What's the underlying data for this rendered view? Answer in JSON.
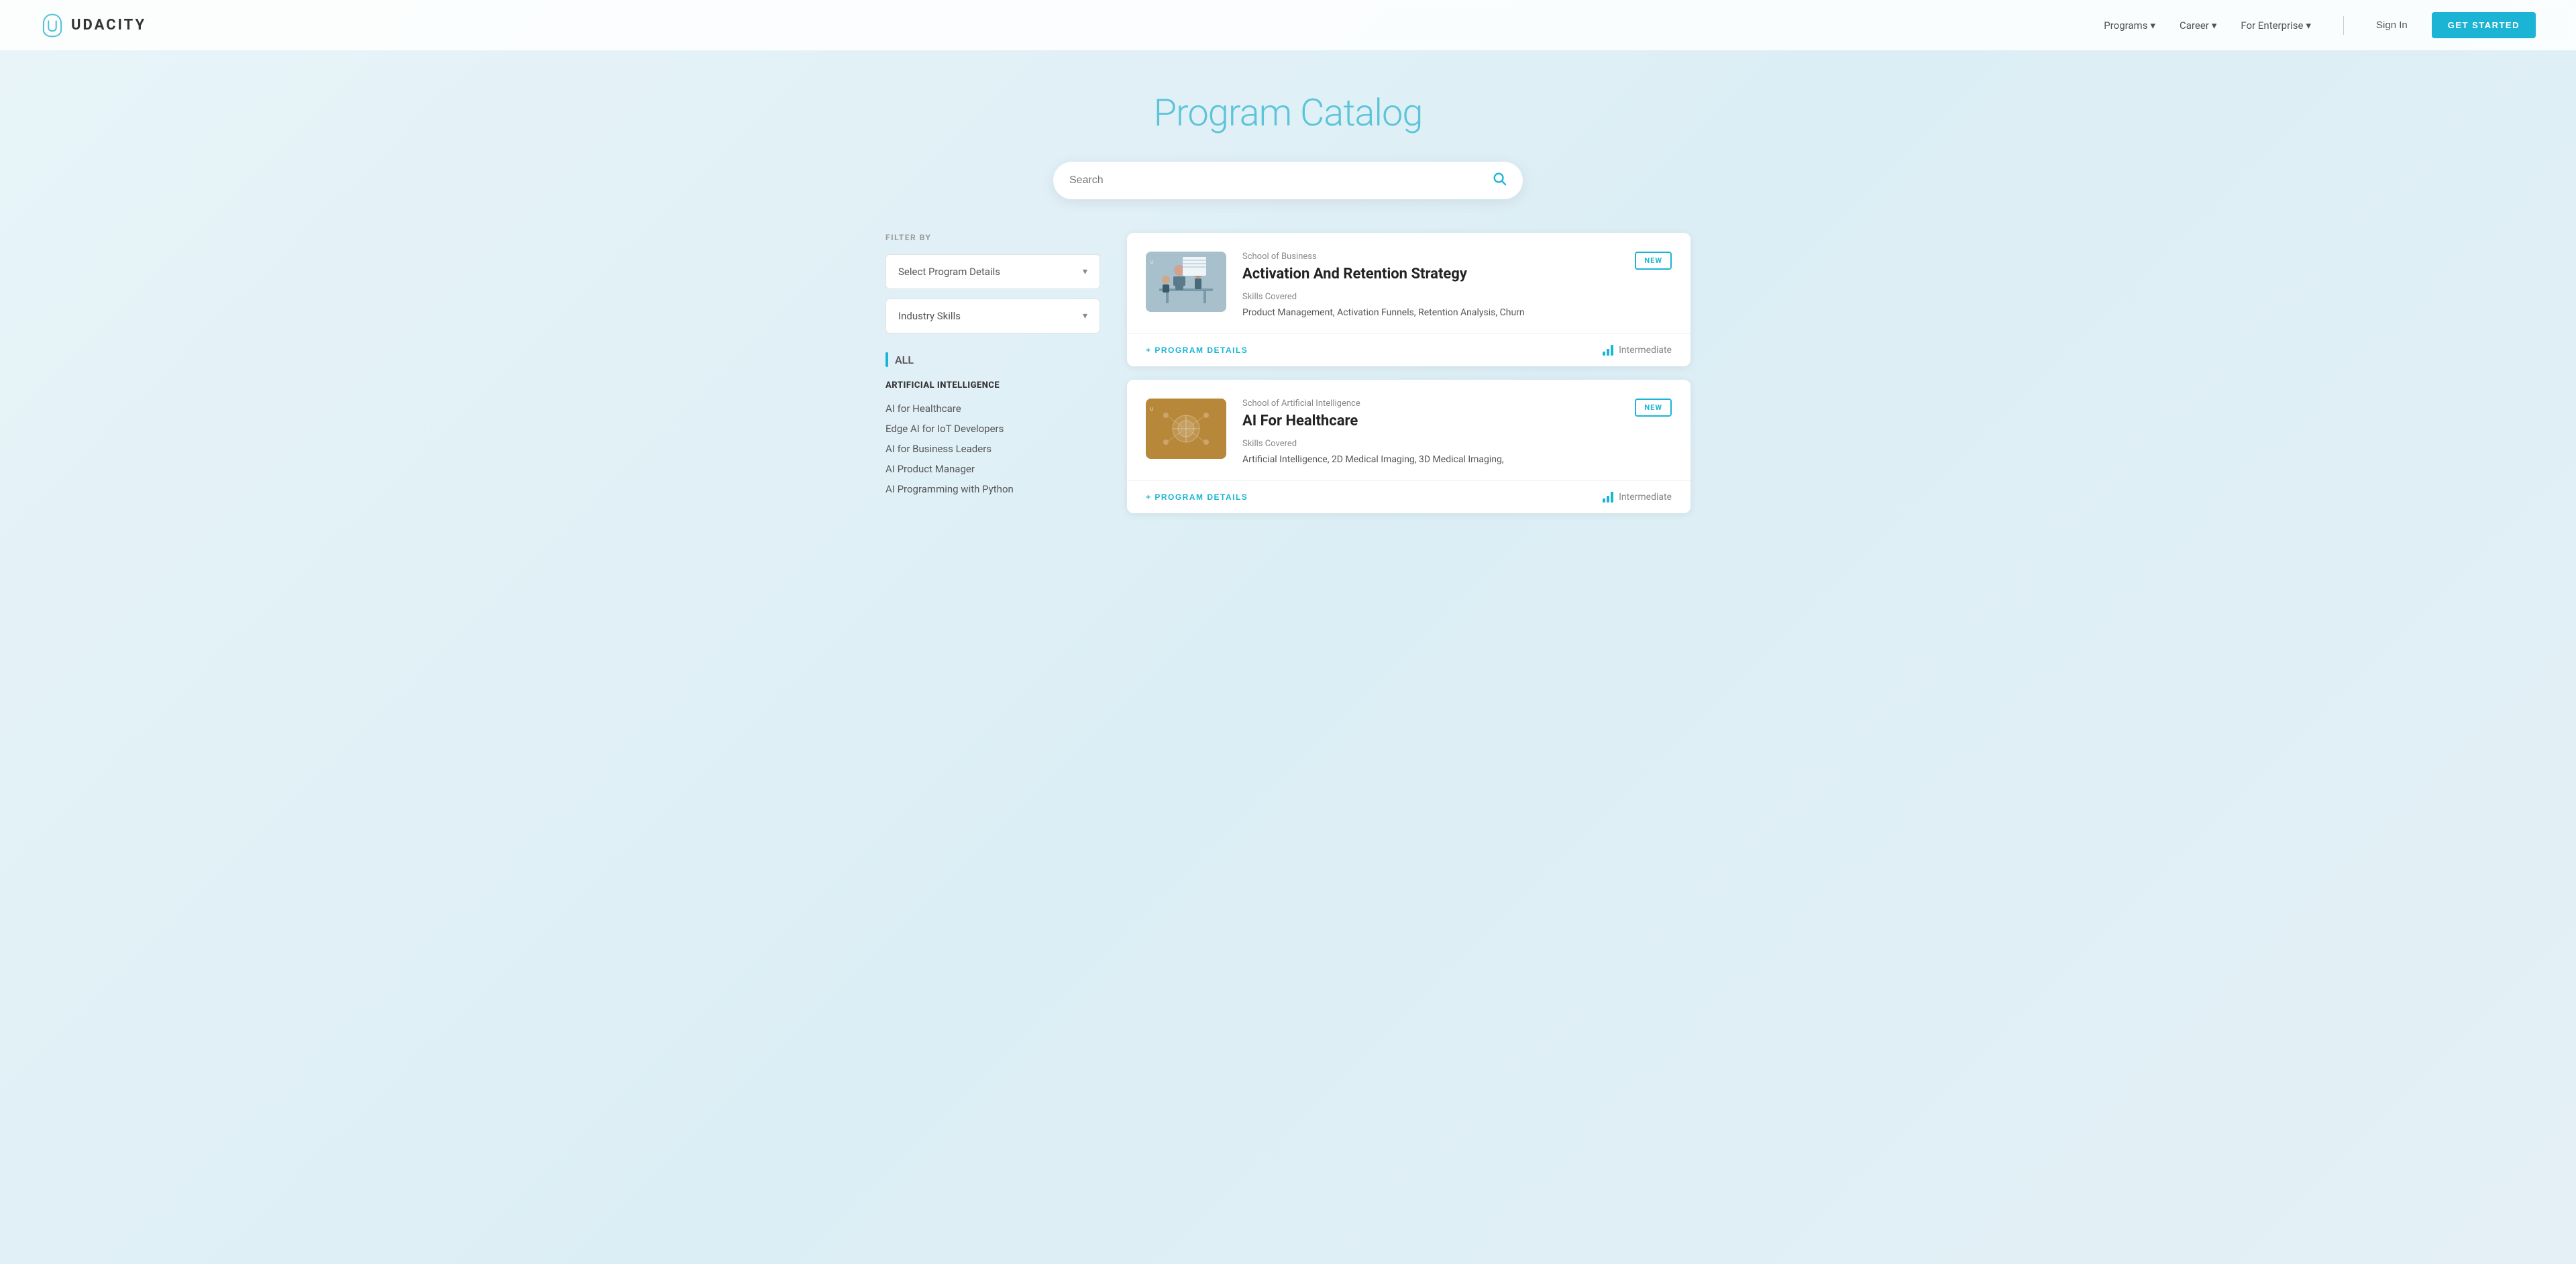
{
  "nav": {
    "logo_text": "UDACITY",
    "links": [
      {
        "label": "Programs",
        "has_arrow": true
      },
      {
        "label": "Career",
        "has_arrow": true
      },
      {
        "label": "For Enterprise",
        "has_arrow": true
      }
    ],
    "sign_in": "Sign In",
    "get_started": "GET STARTED"
  },
  "hero": {
    "title": "Program Catalog"
  },
  "search": {
    "placeholder": "Search"
  },
  "sidebar": {
    "filter_label": "FILTER BY",
    "program_details_placeholder": "Select Program Details",
    "industry_skills_placeholder": "Industry Skills",
    "all_label": "ALL",
    "categories": [
      {
        "name": "ARTIFICIAL INTELLIGENCE",
        "items": [
          "AI for Healthcare",
          "Edge AI for IoT Developers",
          "AI for Business Leaders",
          "AI Product Manager",
          "AI Programming with Python"
        ]
      }
    ]
  },
  "cards": [
    {
      "school": "School of Business",
      "title": "Activation And Retention Strategy",
      "is_new": true,
      "new_badge": "NEW",
      "skills_label": "Skills Covered",
      "skills": "Product Management, Activation Funnels, Retention Analysis, Churn",
      "program_details_btn": "+ PROGRAM DETAILS",
      "level": "Intermediate",
      "thumb_type": "business"
    },
    {
      "school": "School of Artificial Intelligence",
      "title": "AI For Healthcare",
      "is_new": true,
      "new_badge": "NEW",
      "skills_label": "Skills Covered",
      "skills": "Artificial Intelligence, 2D Medical Imaging, 3D Medical Imaging,",
      "program_details_btn": "+ PROGRAM DETAILS",
      "level": "Intermediate",
      "thumb_type": "ai"
    }
  ]
}
